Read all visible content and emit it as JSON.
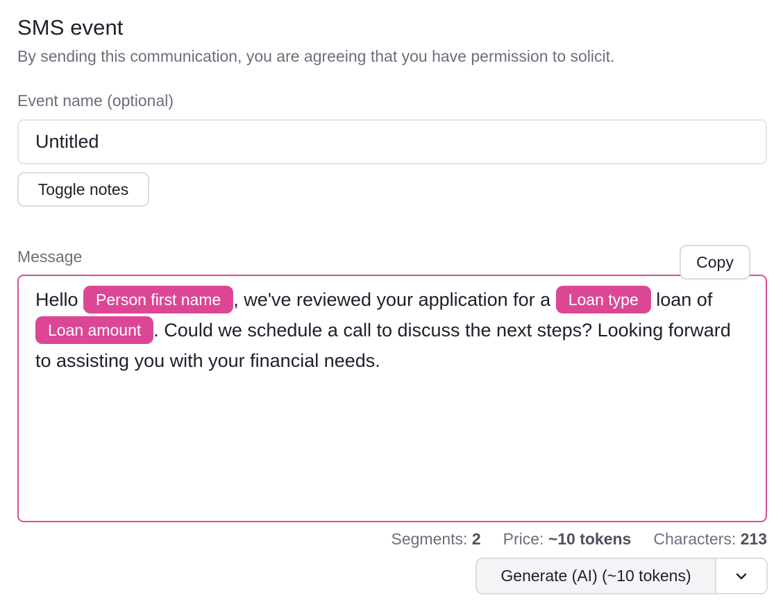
{
  "header": {
    "title": "SMS event",
    "subtitle": "By sending this communication, you are agreeing that you have permission to solicit."
  },
  "event_name": {
    "label": "Event name (optional)",
    "value": "Untitled"
  },
  "buttons": {
    "toggle_notes": "Toggle notes",
    "copy": "Copy",
    "generate": "Generate (AI) (~10 tokens)"
  },
  "message": {
    "label": "Message",
    "greeting": "Hello",
    "chip_person_first_name": "Person first name",
    "text_after_name": ", we've reviewed your application for a",
    "chip_loan_type": "Loan type",
    "text_loan_of": "loan of",
    "chip_loan_amount": "Loan amount",
    "text_rest": ". Could we schedule a call to discuss the next steps? Looking forward to assisting you with your financial needs."
  },
  "stats": {
    "segments_label": "Segments:",
    "segments_value": "2",
    "price_label": "Price:",
    "price_value": "~10 tokens",
    "characters_label": "Characters:",
    "characters_value": "213"
  },
  "icons": {
    "dropdown": "chevron-down-icon"
  },
  "colors": {
    "accent": "#dc4795",
    "border_accent": "#d94d93",
    "muted_text": "#6b6f7b"
  }
}
